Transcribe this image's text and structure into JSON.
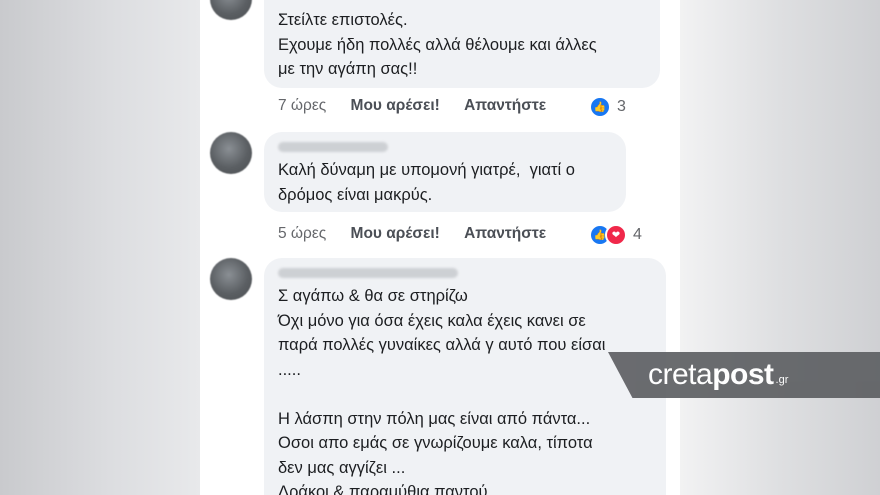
{
  "comments": [
    {
      "lines": [
        "Στείλτε επιστολές.",
        "Εχουμε ήδη πολλές αλλά θέλουμε και άλλες",
        "με την αγάπη σας!!"
      ],
      "time": "7 ώρες",
      "like_label": "Μου αρέσει!",
      "reply_label": "Απαντήστε",
      "reaction_count": "3",
      "reactions": [
        "like-icon"
      ]
    },
    {
      "lines": [
        "Καλή δύναμη με υπομονή γιατρέ,  γιατί ο",
        "δρόμος είναι μακρύς."
      ],
      "time": "5 ώρες",
      "like_label": "Μου αρέσει!",
      "reply_label": "Απαντήστε",
      "reaction_count": "4",
      "reactions": [
        "like-icon",
        "love-icon"
      ]
    },
    {
      "lines": [
        "Σ αγάπω & θα σε στηρίζω",
        "Όχι μόνο για όσα έχεις καλα έχεις κανει σε",
        "παρά πολλές γυναίκες αλλά γ αυτό που είσαι",
        ".....",
        "",
        "Η λάσπη στην πόλη μας είναι από πάντα...",
        "Οσοι απο εμάς σε γνωρίζουμε καλα, τίποτα",
        "δεν μας αγγίζει ...",
        "Δράκοι & παραμύθια παντού ...."
      ]
    }
  ],
  "watermark": {
    "brand_left": "creta",
    "brand_right": "post",
    "tld": ".gr"
  },
  "colors": {
    "bubble": "#f0f2f5",
    "like_blue": "#1877f2",
    "love_red": "#f0284a",
    "meta_gray": "#65676b"
  }
}
